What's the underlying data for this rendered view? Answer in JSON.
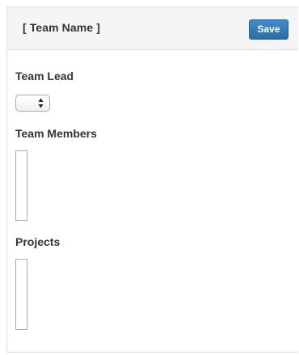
{
  "panel": {
    "title": "[ Team Name ]",
    "save_label": "Save"
  },
  "form": {
    "team_lead": {
      "label": "Team Lead",
      "selected_value": "",
      "icon": "chevron-up-down-icon"
    },
    "team_members": {
      "label": "Team Members",
      "items": []
    },
    "projects": {
      "label": "Projects",
      "items": []
    }
  },
  "colors": {
    "save_button": "#2d6ca2",
    "header_background": "#f5f5f5",
    "border": "#dddddd"
  }
}
